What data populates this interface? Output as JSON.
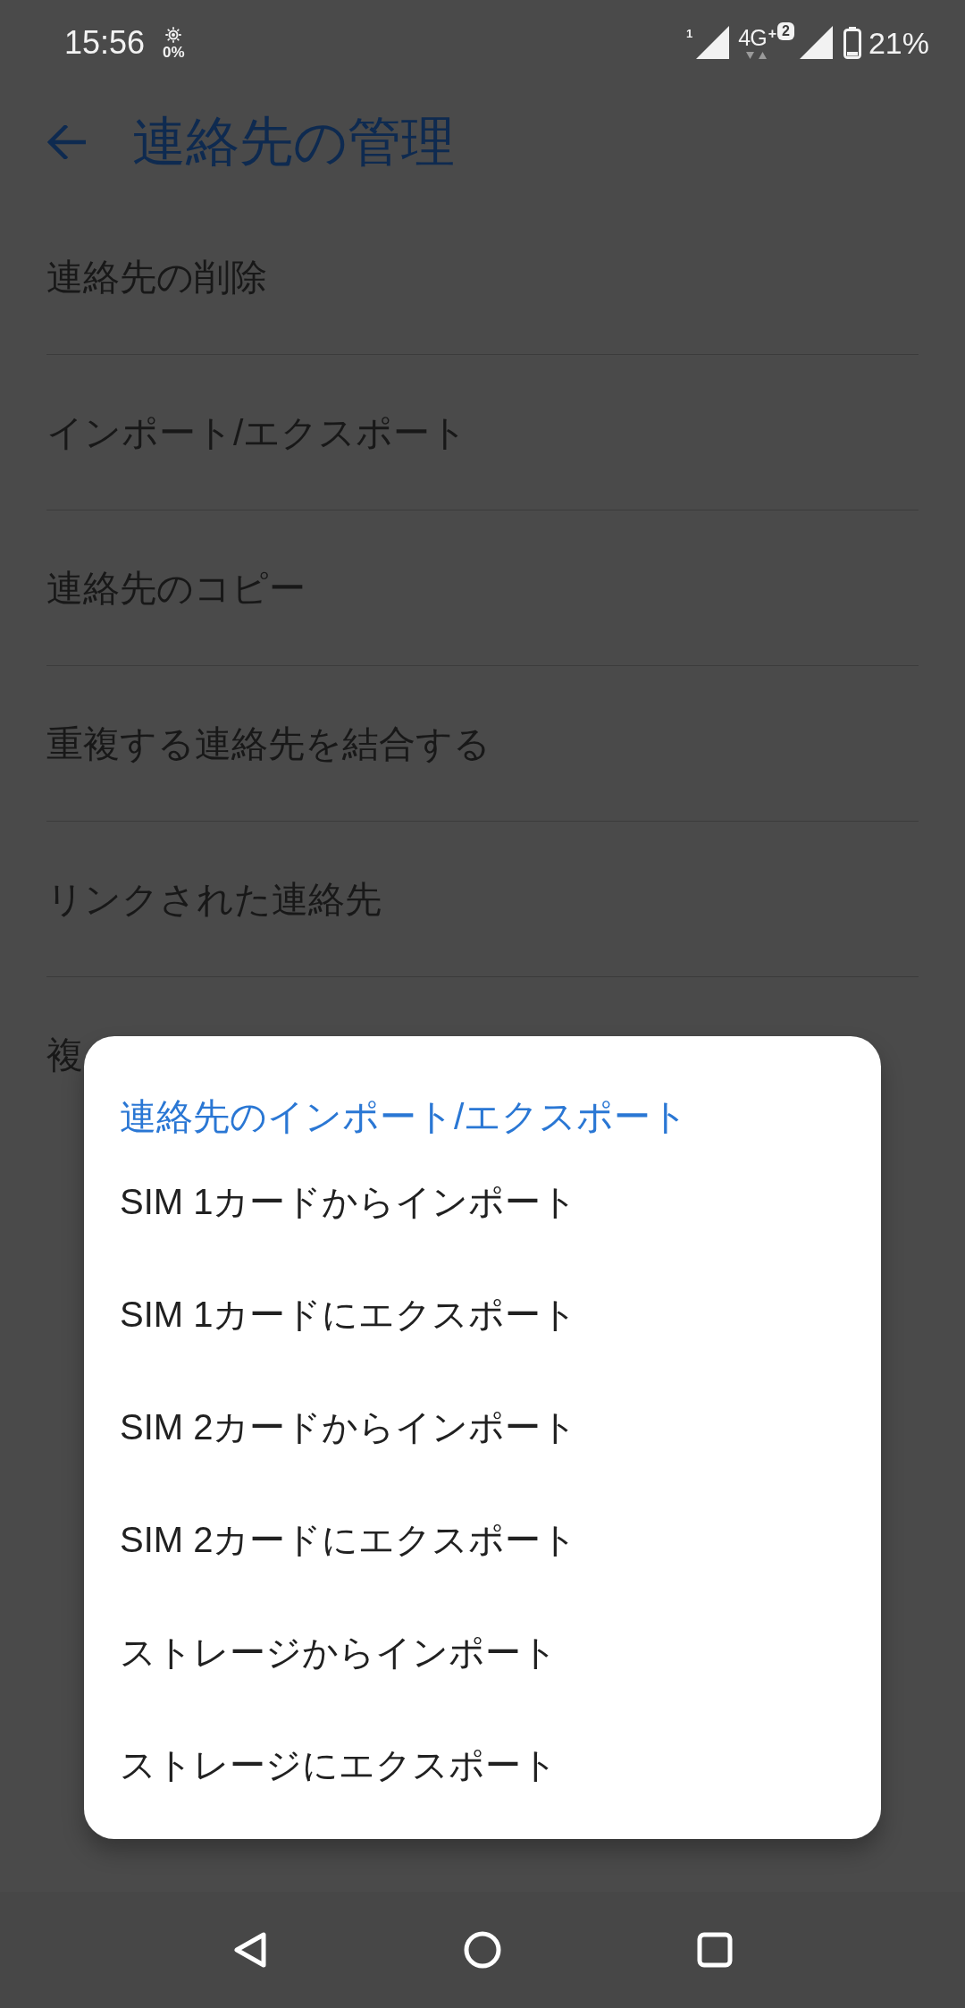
{
  "status_bar": {
    "time": "15:56",
    "notification": {
      "reading": "0%"
    },
    "sim_1": {
      "slot": "1"
    },
    "network": {
      "type": "4G",
      "plus": "+"
    },
    "sim_2": {
      "slot": "2"
    },
    "battery": {
      "reading": "21%"
    }
  },
  "toolbar": {
    "title": "連絡先の管理"
  },
  "settings_list": {
    "items": [
      "連絡先の削除",
      "インポート/エクスポート",
      "連絡先のコピー",
      "重複する連絡先を結合する",
      "リンクされた連絡先",
      "複"
    ]
  },
  "dialog": {
    "title": "連絡先のインポート/エクスポート",
    "options": [
      "SIM 1カードからインポート",
      "SIM 1カードにエクスポート",
      "SIM 2カードからインポート",
      "SIM 2カードにエクスポート",
      "ストレージからインポート",
      "ストレージにエクスポート"
    ]
  }
}
